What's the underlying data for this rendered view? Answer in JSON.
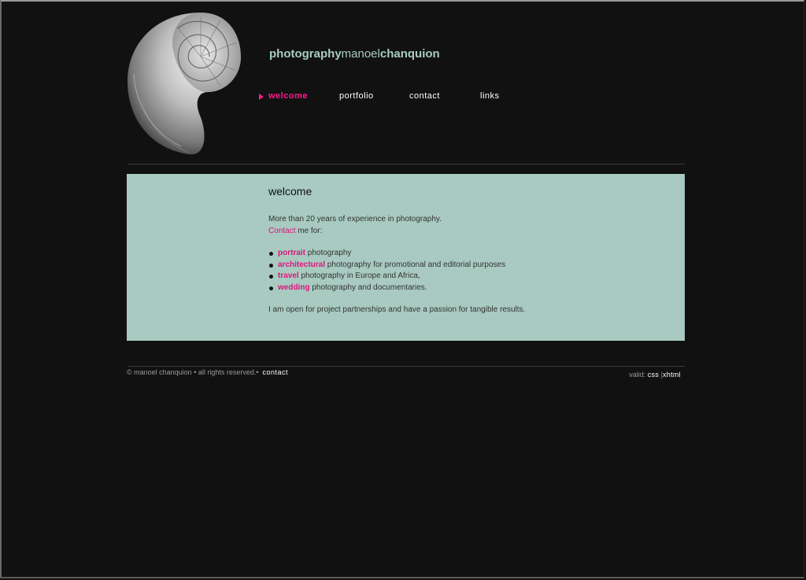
{
  "header": {
    "logo_part1": "photography",
    "logo_part2": "manoel",
    "logo_part3": "chanquion"
  },
  "nav": {
    "items": [
      {
        "label": "welcome",
        "active": true
      },
      {
        "label": "portfolio",
        "active": false
      },
      {
        "label": "contact",
        "active": false
      },
      {
        "label": "links",
        "active": false
      }
    ]
  },
  "content": {
    "title": "welcome",
    "intro_line": "More than 20 years of experience in photography.",
    "contact_link": "Contact",
    "contact_suffix": " me for:",
    "list": [
      {
        "highlight": "portrait",
        "rest": " photography"
      },
      {
        "highlight": "architectural",
        "rest": " photography for promotional and editorial purposes"
      },
      {
        "highlight": "travel",
        "rest": " photography in Europe and Africa,"
      },
      {
        "highlight": "wedding",
        "rest": " photography and documentaries."
      }
    ],
    "closing": "I am open for project partnerships and have a passion for tangible results."
  },
  "footer": {
    "copyright": "© manoel chanquion • all rights reserved.•",
    "contact": "contact",
    "valid_label": "valid:",
    "css": "css",
    "separator": "|",
    "xhtml": "xhtml"
  },
  "colors": {
    "background": "#111111",
    "accent": "#ff1a8c",
    "content_bg": "#a8cac0",
    "logo": "#a8cdc0"
  }
}
